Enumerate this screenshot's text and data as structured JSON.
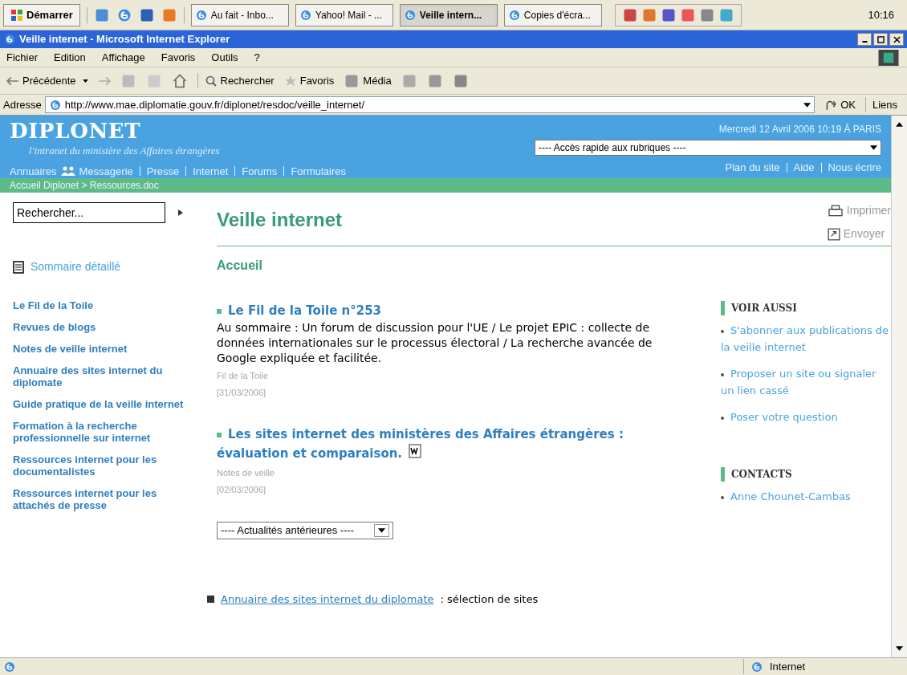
{
  "taskbar": {
    "start": "Démarrer",
    "tasks": [
      {
        "label": "Au fait - Inbo...",
        "selected": false
      },
      {
        "label": "Yahoo! Mail - ...",
        "selected": false
      },
      {
        "label": "Veille intern...",
        "selected": true
      },
      {
        "label": "Copies d'écra...",
        "selected": false
      }
    ],
    "clock": "10:16"
  },
  "window": {
    "title": "Veille internet - Microsoft Internet Explorer"
  },
  "menu": [
    "Fichier",
    "Edition",
    "Affichage",
    "Favoris",
    "Outils",
    "?"
  ],
  "toolbar": {
    "back": "Précédente",
    "search": "Rechercher",
    "favorites": "Favoris",
    "media": "Média"
  },
  "address": {
    "label": "Adresse",
    "value": "http://www.mae.diplomatie.gouv.fr/diplonet/resdoc/veille_internet/",
    "go": "OK",
    "links": "Liens"
  },
  "site": {
    "logo": "DIPLONET",
    "tagline": "l'intranet du ministère des Affaires étrangères",
    "date": "Mercredi 12 Avril 2006 10:19 À PARIS",
    "quick_access": "---- Accès rapide aux rubriques ----",
    "nav": [
      "Annuaires",
      "Messagerie",
      "Presse",
      "Internet",
      "Forums",
      "Formulaires"
    ],
    "utility": [
      "Plan du site",
      "Aide",
      "Nous écrire"
    ],
    "breadcrumb": "Accueil Diplonet > Ressources.doc"
  },
  "sidebar": {
    "search_placeholder": "Rechercher...",
    "summary": "Sommaire détaillé",
    "items": [
      "Le Fil de la Toile",
      "Revues de blogs",
      "Notes de veille internet",
      "Annuaire des sites internet du diplomate",
      "Guide pratique de la veille internet",
      "Formation à la recherche professionnelle sur internet",
      "Ressources internet pour les documentalistes",
      "Ressources internet pour les attachés de presse"
    ]
  },
  "main": {
    "title": "Veille internet",
    "print": "Imprimer",
    "send": "Envoyer",
    "section": "Accueil",
    "articles": [
      {
        "title": "Le Fil de la Toile n°253",
        "summary": "Au sommaire : Un forum de discussion pour l'UE / Le projet EPIC : collecte de données internationales sur le processus électoral / La recherche avancée de Google expliquée et facilitée.",
        "category": "Fil de la Toile",
        "date": "[31/03/2006]",
        "word_doc": false
      },
      {
        "title": "Les sites internet des ministères des Affaires étrangères : évaluation et comparaison.",
        "category": "Notes de veille",
        "date": "[02/03/2006]",
        "word_doc": true
      }
    ],
    "archive_select": "---- Actualités antérieures ----",
    "bottom": {
      "link": "Annuaire des sites internet du diplomate",
      "text": ": sélection de sites"
    }
  },
  "aside": [
    {
      "title": "VOIR AUSSI",
      "links": [
        "S'abonner aux publications de la veille internet",
        "Proposer un site ou signaler un lien cassé",
        "Poser votre question"
      ]
    },
    {
      "title": "CONTACTS",
      "links": [
        "Anne Chounet-Cambas"
      ]
    }
  ],
  "status_bar": {
    "zone": "Internet"
  }
}
